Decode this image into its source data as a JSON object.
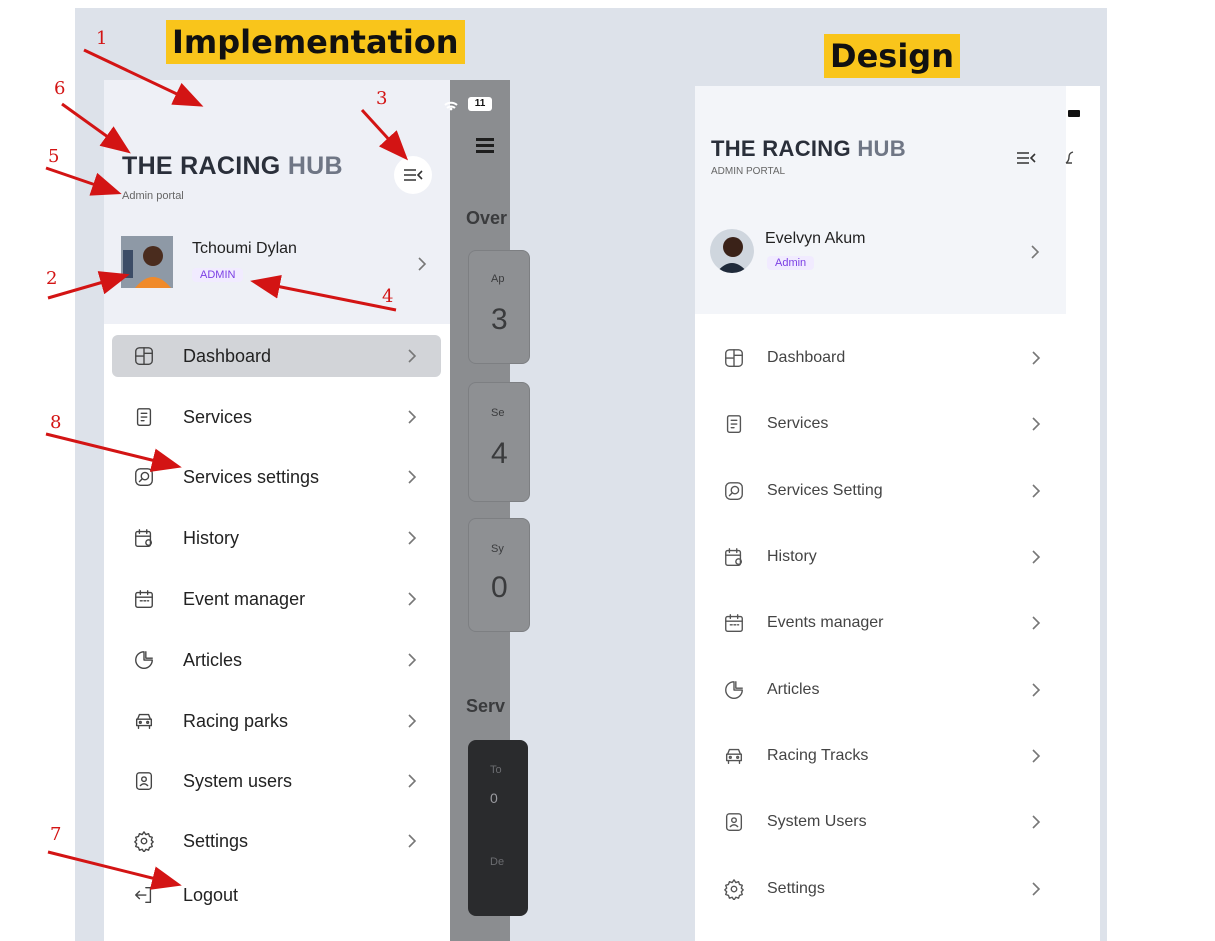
{
  "headers": {
    "implementation": "Implementation",
    "design": "Design"
  },
  "implementation": {
    "status_battery": "11",
    "brand": {
      "title_bold": "THE RACING",
      "title_light": "HUB",
      "subtitle": "Admin portal"
    },
    "user": {
      "name": "Tchoumi Dylan",
      "role": "ADMIN"
    },
    "menu": [
      {
        "label": "Dashboard",
        "icon": "dashboard-icon",
        "active": true
      },
      {
        "label": "Services",
        "icon": "services-icon"
      },
      {
        "label": "Services settings",
        "icon": "services-settings-icon"
      },
      {
        "label": "History",
        "icon": "history-icon"
      },
      {
        "label": "Event manager",
        "icon": "calendar-icon"
      },
      {
        "label": "Articles",
        "icon": "articles-icon"
      },
      {
        "label": "Racing parks",
        "icon": "car-icon"
      },
      {
        "label": "System users",
        "icon": "users-icon"
      },
      {
        "label": "Settings",
        "icon": "gear-icon"
      },
      {
        "label": "Logout",
        "icon": "logout-icon"
      }
    ],
    "background_peek": {
      "overview": "Over",
      "card_labels": [
        "Ap",
        "Se",
        "Sy"
      ],
      "card_values": [
        "3",
        "4",
        "0"
      ],
      "section": "Serv",
      "dark_label": "To",
      "dark_value": "0",
      "dark_label2": "De"
    }
  },
  "design": {
    "brand": {
      "title_bold": "THE RACING",
      "title_light": "HUB",
      "subtitle": "ADMIN PORTAL"
    },
    "user": {
      "name": "Evelvyn Akum",
      "role": "Admin"
    },
    "menu": [
      {
        "label": "Dashboard",
        "icon": "dashboard-icon"
      },
      {
        "label": "Services",
        "icon": "services-icon"
      },
      {
        "label": "Services Setting",
        "icon": "services-settings-icon"
      },
      {
        "label": "History",
        "icon": "history-icon"
      },
      {
        "label": "Events manager",
        "icon": "calendar-icon"
      },
      {
        "label": "Articles",
        "icon": "articles-icon"
      },
      {
        "label": "Racing Tracks",
        "icon": "car-icon"
      },
      {
        "label": "System Users",
        "icon": "users-icon"
      },
      {
        "label": "Settings",
        "icon": "gear-icon"
      }
    ]
  },
  "annotations": [
    "1",
    "2",
    "3",
    "4",
    "5",
    "6",
    "7",
    "8"
  ],
  "colors": {
    "accent_highlight": "#f9c51b",
    "annotation_red": "#d31414",
    "badge_purple": "#7b3fe4",
    "active_item_bg": "#d2d4d8"
  }
}
